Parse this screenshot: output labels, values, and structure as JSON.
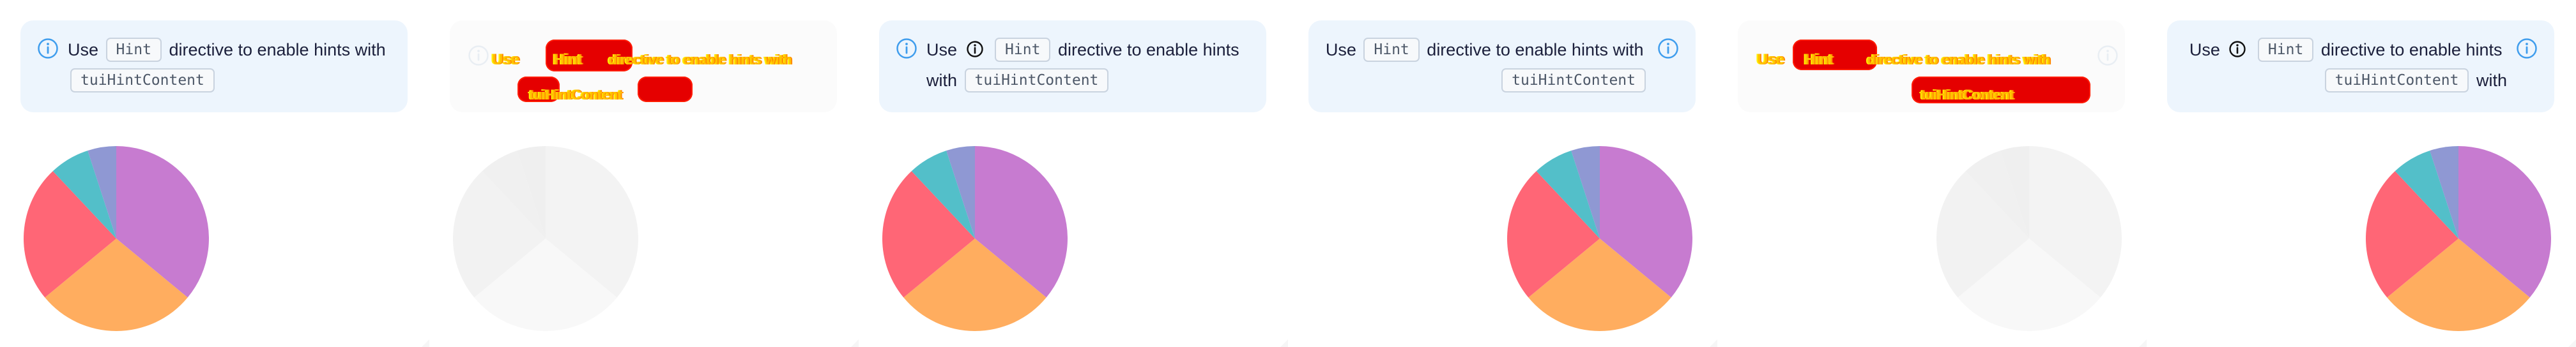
{
  "copy": {
    "use": "Use",
    "hint": "Hint",
    "directive_with": "directive to enable hints with",
    "directive": "directive to enable hints",
    "with": "with",
    "content": "tuiHintContent"
  },
  "panes": [
    {
      "state": "normal",
      "chart_tone": "color"
    },
    {
      "state": "glitched",
      "chart_tone": "ghost"
    },
    {
      "state": "normal",
      "chart_tone": "color"
    },
    {
      "state": "normal",
      "chart_tone": "color"
    },
    {
      "state": "glitched",
      "chart_tone": "ghost"
    },
    {
      "state": "normal",
      "chart_tone": "color"
    }
  ],
  "colors": {
    "blue_icon": "#3f9ded",
    "dark_icon": "#111111",
    "ghost_icon": "#c8d7e7",
    "notice_bg": "#edf5fd",
    "ghost_bg": "#fbfbfb",
    "red_glitch": "#e50000",
    "yellow_glitch": "#ffc000",
    "pie": [
      "#c77bd0",
      "#ffad5f",
      "#ff6676",
      "#53bfc9",
      "#8f98d3"
    ],
    "pie_ghost": [
      "#f3f3f3",
      "#f8f8f8",
      "#f2f2f2",
      "#f0f0f0",
      "#efefef"
    ]
  },
  "chart_data": {
    "type": "pie",
    "values": [
      36,
      28,
      24,
      7,
      5
    ],
    "colors": [
      "#c77bd0",
      "#ffad5f",
      "#ff6676",
      "#53bfc9",
      "#8f98d3"
    ]
  }
}
